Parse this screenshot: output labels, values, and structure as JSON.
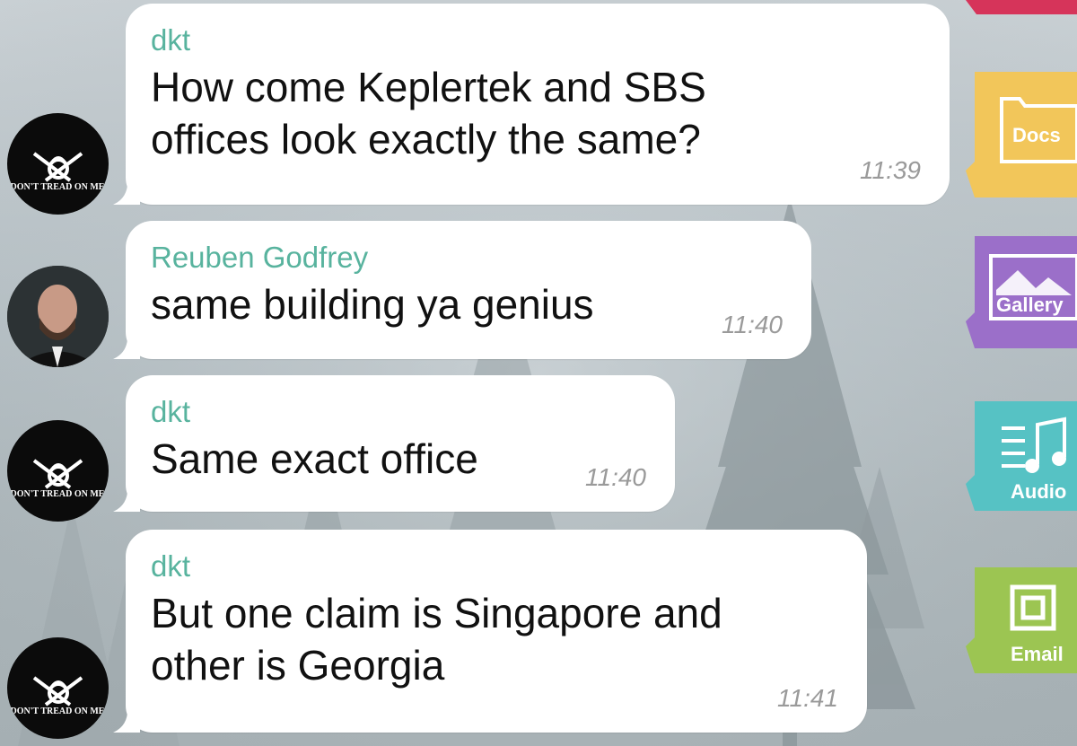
{
  "messages": [
    {
      "sender": "dkt",
      "line1": "How come Keplertek and SBS",
      "line2": "offices look exactly the same?",
      "time": "11:39",
      "avatar": "dont-tread-on-me"
    },
    {
      "sender": "Reuben Godfrey",
      "line1": "same building ya genius",
      "time": "11:40",
      "avatar": "photo-bearded-man"
    },
    {
      "sender": "dkt",
      "line1": "Same exact office",
      "time": "11:40",
      "avatar": "dont-tread-on-me"
    },
    {
      "sender": "dkt",
      "line1": "But one claim is Singapore and",
      "line2": "other is Georgia",
      "time": "11:41",
      "avatar": "dont-tread-on-me"
    }
  ],
  "avatar_text": "DON'T TREAD ON ME",
  "sidebar": {
    "tabs": [
      {
        "label": "Docs",
        "icon": "folder-icon",
        "color": "#f2c65a"
      },
      {
        "label": "Gallery",
        "icon": "image-icon",
        "color": "#9b6fc9"
      },
      {
        "label": "Audio",
        "icon": "music-icon",
        "color": "#56c2c4"
      },
      {
        "label": "Email",
        "icon": "email-icon",
        "color": "#9cc552"
      }
    ],
    "top_tab_color": "#d6345a"
  },
  "colors": {
    "sender": "#58b39e",
    "bubble": "#ffffff",
    "time": "#9a9a9a"
  }
}
